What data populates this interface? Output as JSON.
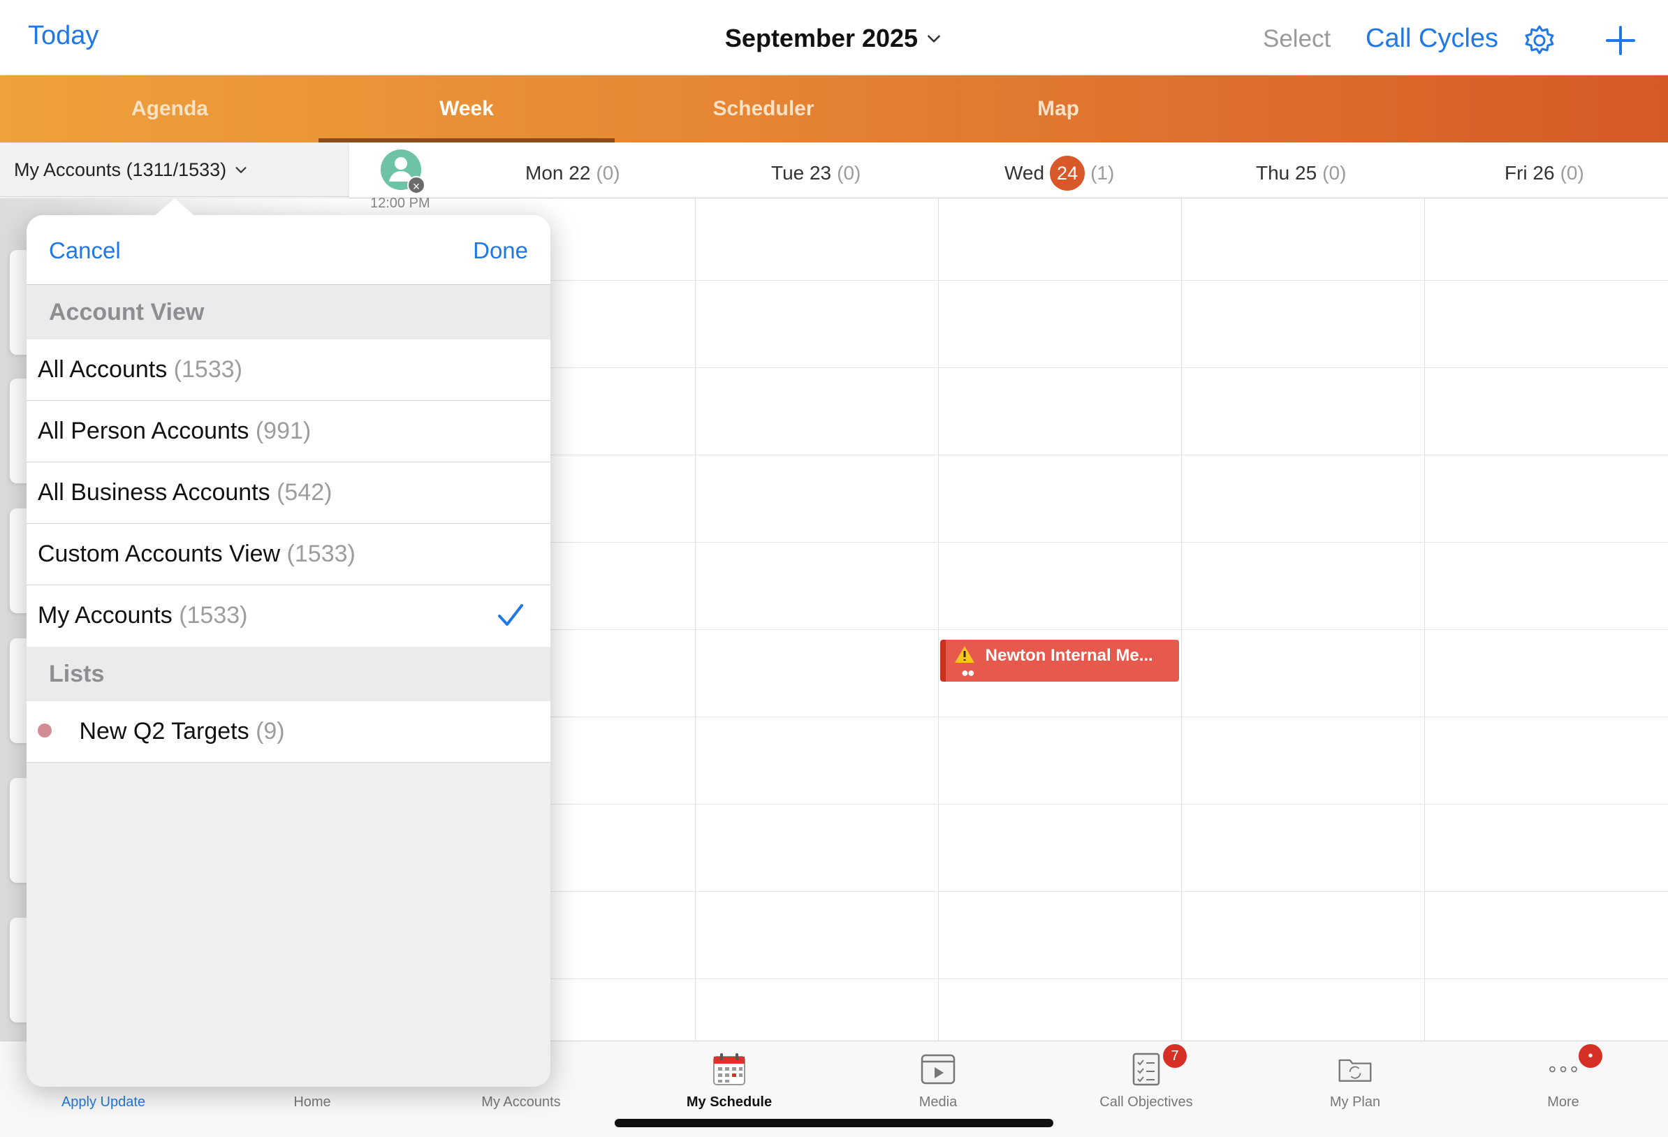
{
  "topbar": {
    "today": "Today",
    "month": "September 2025",
    "select": "Select",
    "call_cycles": "Call Cycles"
  },
  "tabs": [
    "Agenda",
    "Week",
    "Scheduler",
    "Map"
  ],
  "active_tab": "Week",
  "accounts_header": "My Accounts (1311/1533)",
  "time_label": "12:00 PM",
  "days": [
    {
      "label": "Mon 22",
      "count": "(0)"
    },
    {
      "label": "Tue 23",
      "count": "(0)"
    },
    {
      "label": "Wed",
      "date": "24",
      "count": "(1)"
    },
    {
      "label": "Thu 25",
      "count": "(0)"
    },
    {
      "label": "Fri 26",
      "count": "(0)"
    }
  ],
  "event": {
    "title": "Newton Internal Me...",
    "color": "#e7594d"
  },
  "popover": {
    "cancel": "Cancel",
    "done": "Done",
    "section_account_view": "Account View",
    "accounts": [
      {
        "name": "All Accounts",
        "count": "(1533)"
      },
      {
        "name": "All Person Accounts",
        "count": "(991)"
      },
      {
        "name": "All Business Accounts",
        "count": "(542)"
      },
      {
        "name": "Custom Accounts View",
        "count": "(1533)"
      },
      {
        "name": "My Accounts",
        "count": "(1533)",
        "selected": true
      }
    ],
    "section_lists": "Lists",
    "lists": [
      {
        "name": "New Q2 Targets",
        "count": "(9)",
        "color": "#d28d92"
      }
    ]
  },
  "bottom_tabs": [
    {
      "label": "Apply Update",
      "icon": "refresh-icon"
    },
    {
      "label": "Home",
      "icon": "home-icon"
    },
    {
      "label": "My Accounts",
      "icon": "accounts-icon"
    },
    {
      "label": "My Schedule",
      "icon": "calendar-icon",
      "active": true
    },
    {
      "label": "Media",
      "icon": "media-icon"
    },
    {
      "label": "Call Objectives",
      "icon": "checklist-icon",
      "badge": "7"
    },
    {
      "label": "My Plan",
      "icon": "plan-folder-icon"
    },
    {
      "label": "More",
      "icon": "more-dots-icon",
      "badge": "•"
    }
  ],
  "colors": {
    "accent": "#1f78e6",
    "brand_orange": "#e68533",
    "today_badge": "#d8582a",
    "alert_badge": "#d62f26"
  }
}
